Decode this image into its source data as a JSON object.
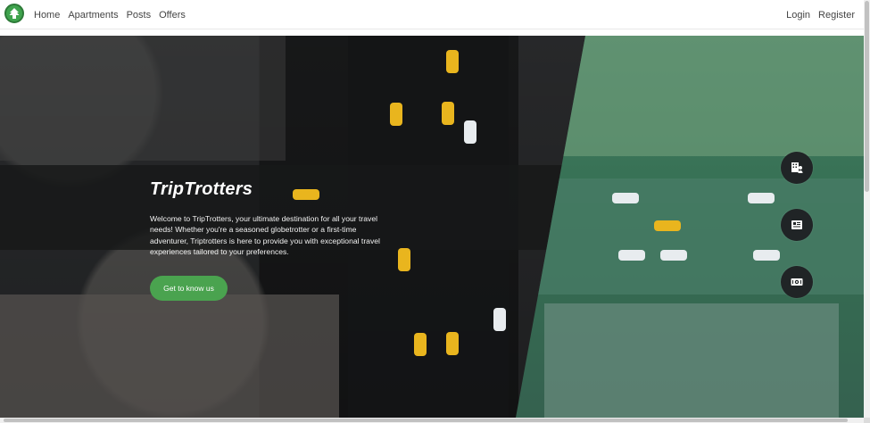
{
  "nav": {
    "left_links": [
      {
        "label": "Home"
      },
      {
        "label": "Apartments"
      },
      {
        "label": "Posts"
      },
      {
        "label": "Offers"
      }
    ],
    "right_links": [
      {
        "label": "Login"
      },
      {
        "label": "Register"
      }
    ],
    "logo_icon": "tree-icon"
  },
  "hero": {
    "title": "TripTrotters",
    "text": "Welcome to TripTrotters, your ultimate destination for all your travel needs! Whether you're a seasoned globetrotter or a first-time adventurer, Triptrotters is here to provide you with exceptional travel experiences tailored to your preferences.",
    "cta_label": "Get to know us"
  },
  "quick_actions": [
    {
      "icon": "apartment-user-icon"
    },
    {
      "icon": "newspaper-icon"
    },
    {
      "icon": "cash-icon"
    }
  ],
  "colors": {
    "primary_green": "#4aa34f",
    "dark_button": "#202426"
  }
}
